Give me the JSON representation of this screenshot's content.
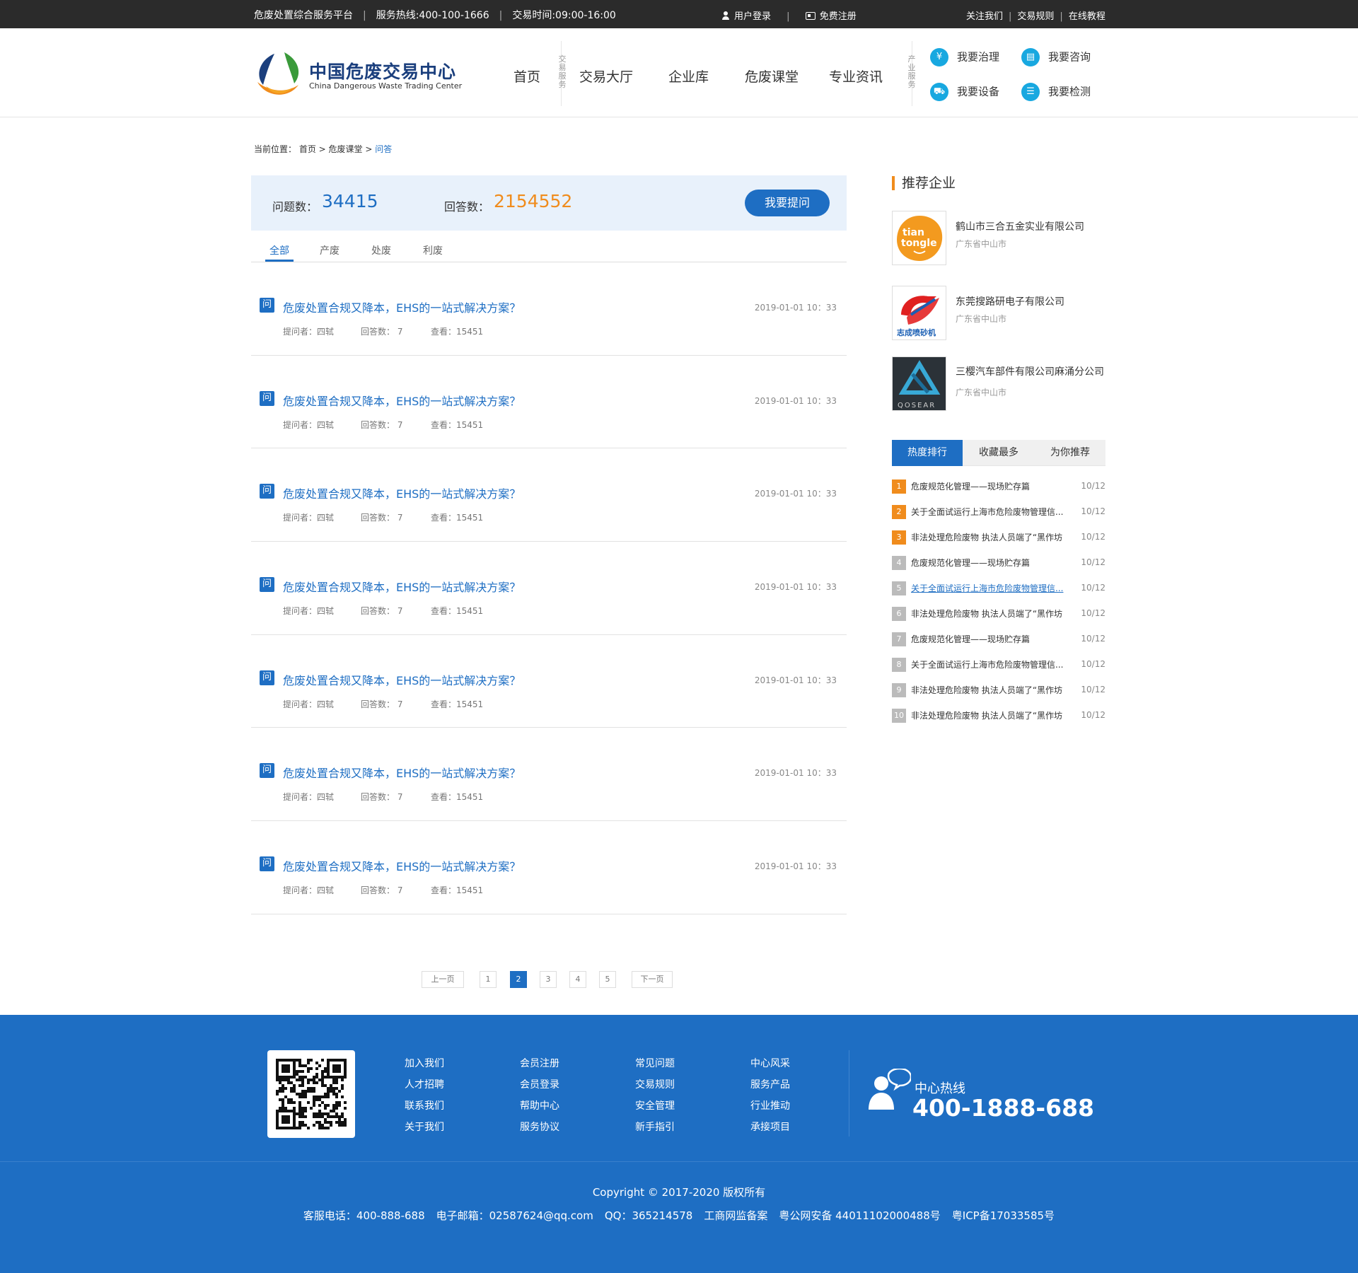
{
  "topbar": {
    "platform": "危废处置综合服务平台",
    "hotline": "服务热线:400-100-1666",
    "hours": "交易时间:09:00-16:00",
    "login": "用户登录",
    "register": "免费注册",
    "links": [
      "关注我们",
      "交易规则",
      "在线教程"
    ]
  },
  "header": {
    "logo_title": "中国危废交易中心",
    "logo_subtitle": "China Dangerous Waste Trading Center",
    "nav": [
      "首页",
      "交易大厅",
      "企业库",
      "危废课堂",
      "专业资讯"
    ],
    "trade_label": "交易服务",
    "industry_label": "产业服务",
    "services": [
      {
        "label": "我要治理",
        "icon": "yen-icon",
        "glyph": "¥"
      },
      {
        "label": "我要咨询",
        "icon": "consult-icon",
        "glyph": "▤"
      },
      {
        "label": "我要设备",
        "icon": "truck-icon",
        "glyph": "⛟"
      },
      {
        "label": "我要检测",
        "icon": "list-icon",
        "glyph": "☰"
      }
    ]
  },
  "breadcrumb": {
    "prefix": "当前位置：",
    "home": "首页",
    "section": "危废课堂",
    "current": "问答"
  },
  "stats": {
    "questions_label": "问题数：",
    "questions": "34415",
    "answers_label": "回答数：",
    "answers": "2154552",
    "ask_button": "我要提问"
  },
  "tabs": [
    "全部",
    "产废",
    "处废",
    "利废"
  ],
  "questions": [
    {
      "icon": "问",
      "title": "危废处置合规又降本，EHS的一站式解决方案？",
      "date": "2019-01-01 10：33",
      "asker": "提问者：四轼",
      "answers": "回答数： 7",
      "views": "查看：15451"
    },
    {
      "icon": "问",
      "title": "危废处置合规又降本，EHS的一站式解决方案？",
      "date": "2019-01-01 10：33",
      "asker": "提问者：四轼",
      "answers": "回答数： 7",
      "views": "查看：15451"
    },
    {
      "icon": "问",
      "title": "危废处置合规又降本，EHS的一站式解决方案？",
      "date": "2019-01-01 10：33",
      "asker": "提问者：四轼",
      "answers": "回答数： 7",
      "views": "查看：15451"
    },
    {
      "icon": "问",
      "title": "危废处置合规又降本，EHS的一站式解决方案？",
      "date": "2019-01-01 10：33",
      "asker": "提问者：四轼",
      "answers": "回答数： 7",
      "views": "查看：15451"
    },
    {
      "icon": "问",
      "title": "危废处置合规又降本，EHS的一站式解决方案？",
      "date": "2019-01-01 10：33",
      "asker": "提问者：四轼",
      "answers": "回答数： 7",
      "views": "查看：15451"
    },
    {
      "icon": "问",
      "title": "危废处置合规又降本，EHS的一站式解决方案？",
      "date": "2019-01-01 10：33",
      "asker": "提问者：四轼",
      "answers": "回答数： 7",
      "views": "查看：15451"
    },
    {
      "icon": "问",
      "title": "危废处置合规又降本，EHS的一站式解决方案？",
      "date": "2019-01-01 10：33",
      "asker": "提问者：四轼",
      "answers": "回答数： 7",
      "views": "查看：15451"
    }
  ],
  "pagination": {
    "prev": "上一页",
    "pages": [
      "1",
      "2",
      "3",
      "4",
      "5"
    ],
    "current": "2",
    "next": "下一页"
  },
  "sidebar": {
    "title": "推荐企业",
    "companies": [
      {
        "name": "鹤山市三合五金实业有限公司",
        "location": "广东省中山市",
        "logo_text": "tian tongle"
      },
      {
        "name": "东莞搜路研电子有限公司",
        "location": "广东省中山市",
        "logo_text": "志成喷砂机"
      },
      {
        "name": "三樱汽车部件有限公司麻涌分公司",
        "location": "广东省中山市",
        "logo_text": "QOSEAR"
      }
    ],
    "rank_tabs": [
      "热度排行",
      "收藏最多",
      "为你推荐"
    ],
    "ranking": [
      {
        "n": "1",
        "text": "危废规范化管理——现场贮存篇",
        "date": "10/12"
      },
      {
        "n": "2",
        "text": "关于全面试运行上海市危险废物管理信...",
        "date": "10/12"
      },
      {
        "n": "3",
        "text": "非法处理危险废物 执法人员端了“黑作坊",
        "date": "10/12"
      },
      {
        "n": "4",
        "text": "危废规范化管理——现场贮存篇",
        "date": "10/12"
      },
      {
        "n": "5",
        "text": "关于全面试运行上海市危险废物管理信...",
        "date": "10/12"
      },
      {
        "n": "6",
        "text": "非法处理危险废物 执法人员端了“黑作坊",
        "date": "10/12"
      },
      {
        "n": "7",
        "text": "危废规范化管理——现场贮存篇",
        "date": "10/12"
      },
      {
        "n": "8",
        "text": "关于全面试运行上海市危险废物管理信...",
        "date": "10/12"
      },
      {
        "n": "9",
        "text": "非法处理危险废物 执法人员端了“黑作坊",
        "date": "10/12"
      },
      {
        "n": "10",
        "text": "非法处理危险废物 执法人员端了“黑作坊",
        "date": "10/12"
      }
    ]
  },
  "footer": {
    "links": [
      [
        "加入我们",
        "人才招聘",
        "联系我们",
        "关于我们"
      ],
      [
        "会员注册",
        "会员登录",
        "帮助中心",
        "服务协议"
      ],
      [
        "常见问题",
        "交易规则",
        "安全管理",
        "新手指引"
      ],
      [
        "中心风采",
        "服务产品",
        "行业推动",
        "承接项目"
      ]
    ],
    "hotline_label": "中心热线",
    "hotline": "400-1888-688",
    "copyright": "Copyright © 2017-2020  版权所有",
    "contact": [
      "客服电话：400-888-688",
      "电子邮箱：02587624@qq.com",
      "QQ：365214578",
      "工商网监备案",
      "粤公网安备 44011102000488号",
      "粤ICP备17033585号"
    ]
  },
  "colors": {
    "brand_blue": "#1e6ec3",
    "accent_orange": "#f08c1d",
    "topbar": "#2b2b2b",
    "service_icon": "#18a8e0"
  }
}
